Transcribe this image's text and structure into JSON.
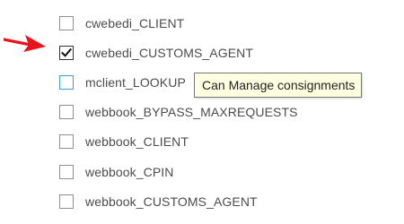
{
  "items": [
    {
      "label": "cwebedi_CLIENT",
      "checked": false
    },
    {
      "label": "cwebedi_CUSTOMS_AGENT",
      "checked": true
    },
    {
      "label": "mclient_LOOKUP",
      "checked": false,
      "focused": true
    },
    {
      "label": "webbook_BYPASS_MAXREQUESTS",
      "checked": false
    },
    {
      "label": "webbook_CLIENT",
      "checked": false
    },
    {
      "label": "webbook_CPIN",
      "checked": false
    },
    {
      "label": "webbook_CUSTOMS_AGENT",
      "checked": false
    }
  ],
  "tooltip": {
    "text": "Can Manage consignments"
  },
  "annotation": {
    "icon": "red-arrow-icon",
    "color": "#e8141c"
  },
  "colors": {
    "checkbox_border": "#8f8f8f",
    "focused_border": "#3d9fe0",
    "tooltip_bg": "#ffffe1",
    "label": "#4c4c4c"
  }
}
